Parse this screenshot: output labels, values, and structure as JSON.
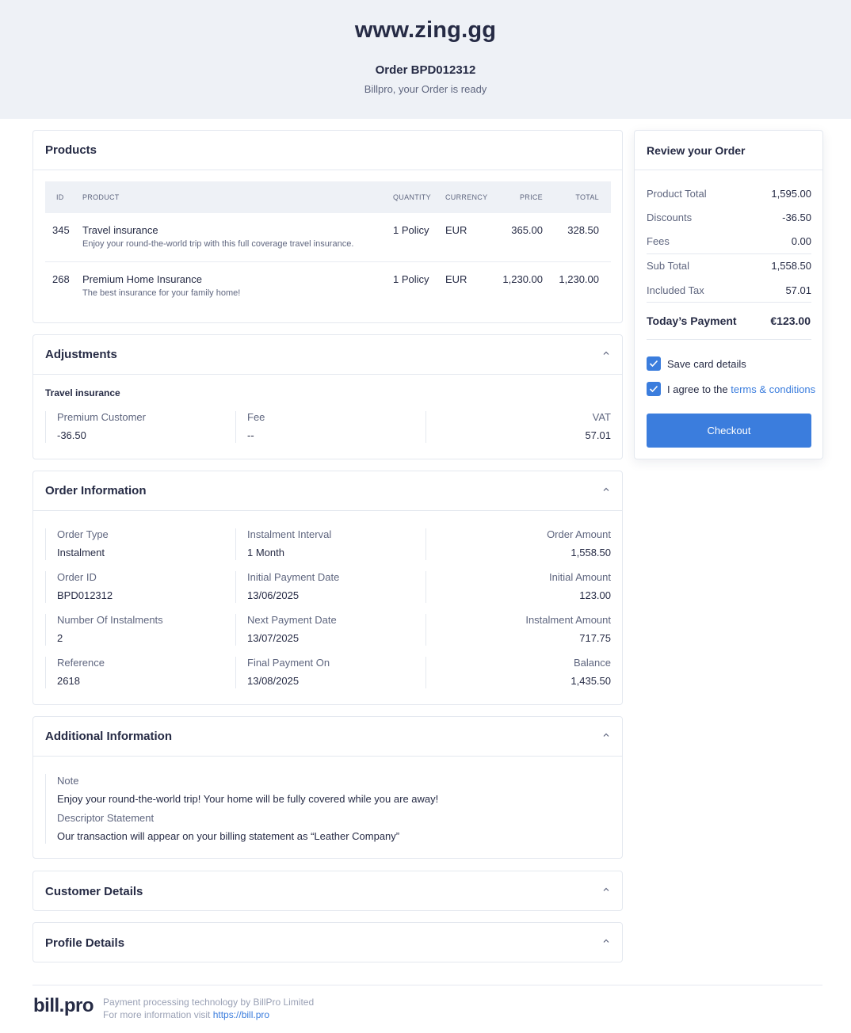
{
  "header": {
    "site": "www.zing.gg",
    "order_title": "Order BPD012312",
    "subtitle": "Billpro, your Order is ready"
  },
  "products": {
    "title": "Products",
    "columns": [
      "ID",
      "PRODUCT",
      "QUANTITY",
      "CURRENCY",
      "PRICE",
      "TOTAL"
    ],
    "rows": [
      {
        "id": "345",
        "name": "Travel insurance",
        "desc": "Enjoy your round-the-world trip with this full coverage travel insurance.",
        "quantity": "1 Policy",
        "currency": "EUR",
        "price": "365.00",
        "total": "328.50"
      },
      {
        "id": "268",
        "name": "Premium Home Insurance",
        "desc": "The best insurance for your family home!",
        "quantity": "1 Policy",
        "currency": "EUR",
        "price": "1,230.00",
        "total": "1,230.00"
      }
    ]
  },
  "adjustments": {
    "title": "Adjustments",
    "product": "Travel insurance",
    "cells": [
      {
        "label": "Premium Customer",
        "value": "-36.50"
      },
      {
        "label": "Fee",
        "value": "--"
      },
      {
        "label": "VAT",
        "value": "57.01"
      }
    ]
  },
  "order_info": {
    "title": "Order Information",
    "rows": [
      [
        {
          "label": "Order Type",
          "value": "Instalment"
        },
        {
          "label": "Instalment Interval",
          "value": "1 Month"
        },
        {
          "label": "Order Amount",
          "value": "1,558.50"
        }
      ],
      [
        {
          "label": "Order ID",
          "value": "BPD012312"
        },
        {
          "label": "Initial Payment Date",
          "value": "13/06/2025"
        },
        {
          "label": "Initial Amount",
          "value": "123.00"
        }
      ],
      [
        {
          "label": "Number Of Instalments",
          "value": "2"
        },
        {
          "label": "Next Payment Date",
          "value": "13/07/2025"
        },
        {
          "label": "Instalment Amount",
          "value": "717.75"
        }
      ],
      [
        {
          "label": "Reference",
          "value": "2618"
        },
        {
          "label": "Final Payment On",
          "value": "13/08/2025"
        },
        {
          "label": "Balance",
          "value": "1,435.50"
        }
      ]
    ]
  },
  "additional_info": {
    "title": "Additional Information",
    "note_label": "Note",
    "note": "Enjoy your round-the-world trip! Your home will be fully covered while you are away!",
    "descriptor_label": "Descriptor Statement",
    "descriptor": "Our transaction will appear on your billing statement as “Leather Company”"
  },
  "customer_details": {
    "title": "Customer Details"
  },
  "profile_details": {
    "title": "Profile Details"
  },
  "review": {
    "title": "Review your Order",
    "lines": [
      {
        "label": "Product Total",
        "value": "1,595.00"
      },
      {
        "label": "Discounts",
        "value": "-36.50"
      },
      {
        "label": "Fees",
        "value": "0.00"
      },
      {
        "label": "Sub Total",
        "value": "1,558.50"
      },
      {
        "label": "Included Tax",
        "value": "57.01"
      }
    ],
    "today_label": "Today’s Payment",
    "today_value": "€123.00",
    "save_card": "Save card details",
    "save_card_checked": true,
    "agree_prefix": "I agree to the ",
    "agree_link": "terms & conditions",
    "agree_checked": true,
    "checkout": "Checkout"
  },
  "footer": {
    "logo": "bill.pro",
    "line1": "Payment processing technology by BillPro Limited",
    "line2_prefix": "For more information visit ",
    "line2_link": "https://bill.pro"
  },
  "colors": {
    "accent": "#3b7ddd",
    "header_bg": "#eef1f6",
    "text": "#262b45",
    "muted": "#5f667f"
  }
}
